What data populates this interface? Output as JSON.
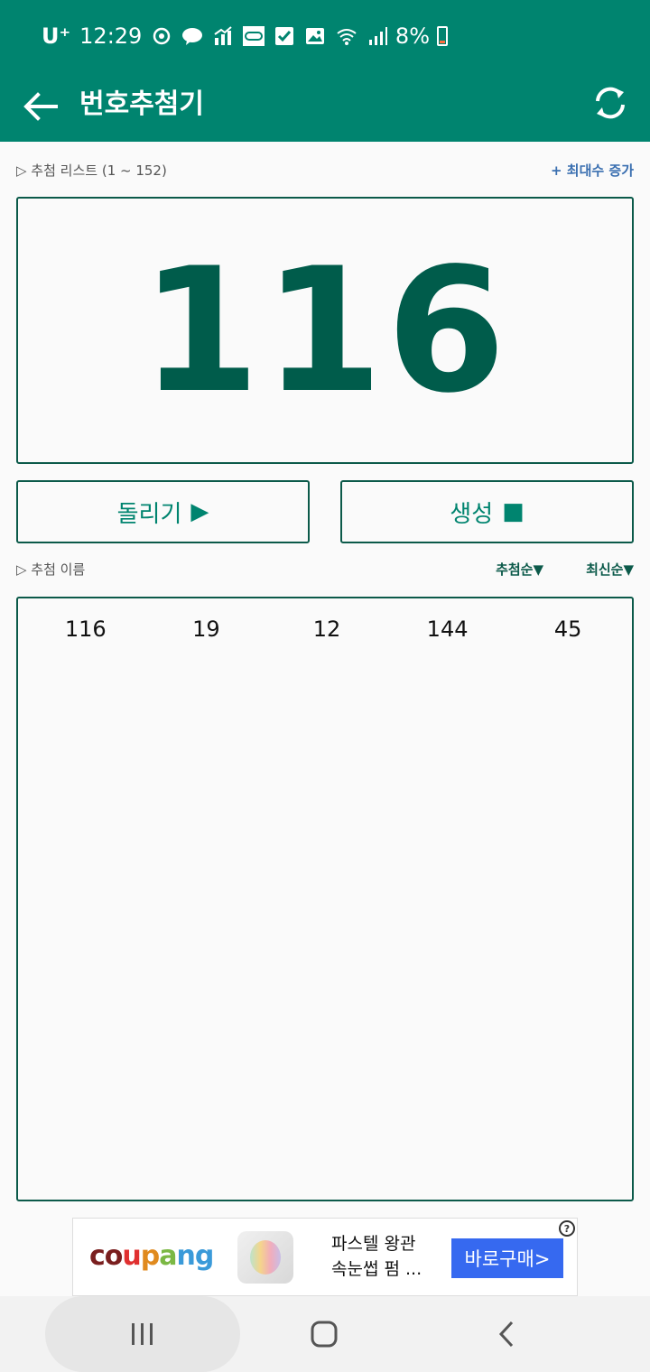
{
  "status": {
    "carrier": "U⁺",
    "time": "12:29",
    "battery": "8%"
  },
  "appbar": {
    "title": "번호추첨기"
  },
  "list_label": {
    "text": "▷ 추첨 리스트 (1 ~ 152)",
    "increase": "+ 최대수 증가"
  },
  "draw": {
    "current": "116"
  },
  "buttons": {
    "spin": "돌리기",
    "spin_glyph": "▶",
    "generate": "생성",
    "generate_glyph": "■"
  },
  "results_label": {
    "text": "▷ 추첨 이름",
    "sort_draw": "추첨순▼",
    "sort_recent": "최신순▼"
  },
  "results": [
    "116",
    "19",
    "12",
    "144",
    "45"
  ],
  "ad": {
    "brand_letters": [
      "c",
      "o",
      "u",
      "p",
      "a",
      "n",
      "g"
    ],
    "line1": "파스텔 왕관",
    "line2": "속눈썹 펌 ...",
    "cta": "바로구매>",
    "info": "?"
  },
  "colors": {
    "primary": "#00846f",
    "dark": "#005c4b",
    "cta": "#3669f0"
  }
}
